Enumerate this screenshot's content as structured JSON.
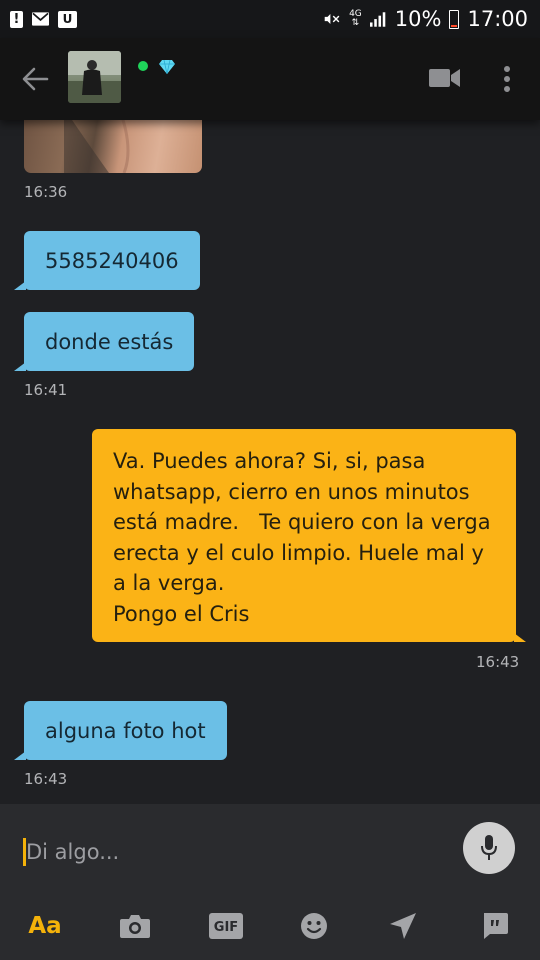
{
  "status_bar": {
    "network": "4G",
    "battery": "10%",
    "time": "17:00",
    "notification_badge": "U",
    "icons": [
      "alert-icon",
      "mail-icon",
      "app-u-icon",
      "mute-icon",
      "network-4g-icon",
      "signal-icon",
      "battery-icon"
    ]
  },
  "header": {
    "icons": [
      "back-arrow-icon",
      "online-status-icon",
      "diamond-icon",
      "video-camera-icon",
      "more-vertical-icon"
    ],
    "online_color": "#1fd35a",
    "diamond_color": "#5fd8f2"
  },
  "messages": [
    {
      "type": "image",
      "direction": "incoming",
      "time": "16:36"
    },
    {
      "type": "text",
      "direction": "incoming",
      "text": "5585240406"
    },
    {
      "type": "text",
      "direction": "incoming",
      "text": "donde estás",
      "time": "16:41"
    },
    {
      "type": "text",
      "direction": "outgoing",
      "lines": [
        "Va. Puedes ahora? Si, si, pasa",
        "whatsapp, cierro en unos minutos",
        "está madre.   Te quiero con la verga",
        "erecta y el culo limpio. Huele mal y",
        "a la verga.",
        "Pongo el Cris"
      ],
      "time": "16:43"
    },
    {
      "type": "text",
      "direction": "incoming",
      "text": "alguna foto hot",
      "time": "16:43"
    }
  ],
  "input": {
    "placeholder": "Di algo..."
  },
  "toolbar": {
    "text_label": "Aa",
    "gif_label": "GIF",
    "icons": [
      "text-format-icon",
      "camera-icon",
      "gif-icon",
      "emoji-icon",
      "location-icon",
      "saved-phrases-icon"
    ]
  },
  "colors": {
    "background": "#1f2023",
    "incoming_bubble": "#6bbfe6",
    "outgoing_bubble": "#fbb316",
    "accent": "#f4b20a",
    "header": "#141414"
  }
}
